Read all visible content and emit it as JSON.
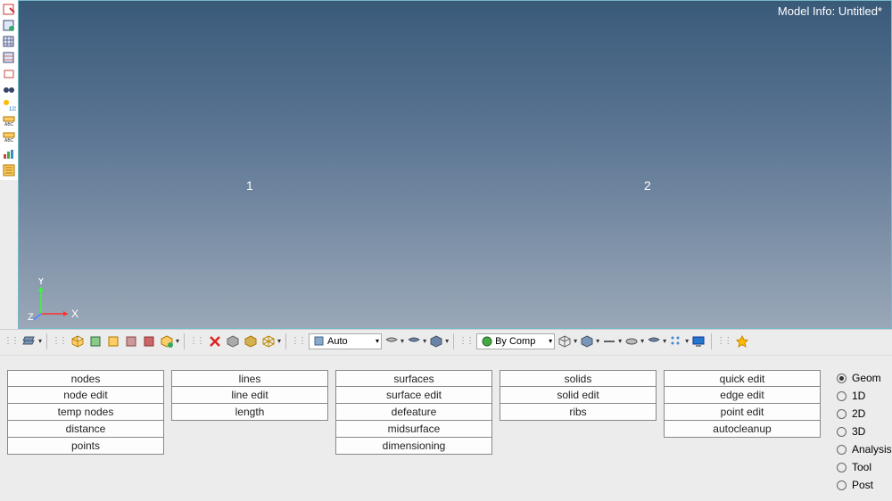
{
  "model_info": "Model Info: Untitled*",
  "viewport_markers": {
    "n1": "1",
    "n2": "2"
  },
  "axes": {
    "x": "X",
    "y": "Y",
    "z": "Z"
  },
  "toolbar_combos": {
    "auto": "Auto",
    "bycomp": "By Comp"
  },
  "panel": {
    "col0": [
      "nodes",
      "node edit",
      "temp nodes",
      "distance",
      "points"
    ],
    "col1": [
      "lines",
      "line edit",
      "length",
      "",
      ""
    ],
    "col2": [
      "surfaces",
      "surface edit",
      "defeature",
      "midsurface",
      "dimensioning"
    ],
    "col3": [
      "solids",
      "solid edit",
      "ribs",
      "",
      ""
    ],
    "col4": [
      "quick edit",
      "edge edit",
      "point edit",
      "autocleanup",
      ""
    ]
  },
  "radios": [
    "Geom",
    "1D",
    "2D",
    "3D",
    "Analysis",
    "Tool",
    "Post"
  ],
  "radio_selected": 0
}
